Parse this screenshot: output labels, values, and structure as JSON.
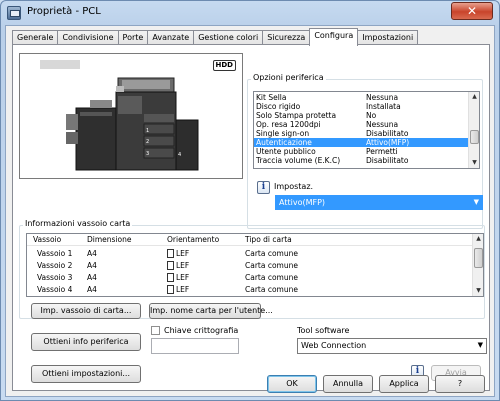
{
  "window": {
    "title": "Proprietà - PCL",
    "close_glyph": "✕"
  },
  "tabs": [
    "Generale",
    "Condivisione",
    "Porte",
    "Avanzate",
    "Gestione colori",
    "Sicurezza",
    "Configura",
    "Impostazioni"
  ],
  "active_tab": "Configura",
  "device_image": {
    "hdd_badge": "HDD"
  },
  "options": {
    "group_title": "Opzioni periferica",
    "rows": [
      {
        "name": "Kit Sella",
        "value": "Nessuna"
      },
      {
        "name": "Disco rigido",
        "value": "Installata"
      },
      {
        "name": "Solo Stampa protetta",
        "value": "No"
      },
      {
        "name": "Op. resa 1200dpi",
        "value": "Nessuna"
      },
      {
        "name": "Single sign-on",
        "value": "Disabilitato"
      },
      {
        "name": "Autenticazione",
        "value": "Attivo(MFP)"
      },
      {
        "name": "Utente pubblico",
        "value": "Permetti"
      },
      {
        "name": "Traccia volume (E.K.C)",
        "value": "Disabilitato"
      }
    ],
    "selected_index": 5,
    "setting_label": "Impostaz.",
    "setting_value": "Attivo(MFP)"
  },
  "tray_info": {
    "group_title": "Informazioni vassoio carta",
    "columns": [
      "Vassoio",
      "Dimensione",
      "Orientamento",
      "Tipo di carta"
    ],
    "rows": [
      {
        "tray": "Vassoio 1",
        "size": "A4",
        "orientation": "LEF",
        "type": "Carta comune"
      },
      {
        "tray": "Vassoio 2",
        "size": "A4",
        "orientation": "LEF",
        "type": "Carta comune"
      },
      {
        "tray": "Vassoio 3",
        "size": "A4",
        "orientation": "LEF",
        "type": "Carta comune"
      },
      {
        "tray": "Vassoio 4",
        "size": "A4",
        "orientation": "LEF",
        "type": "Carta comune"
      }
    ]
  },
  "buttons": {
    "tray_settings": "Imp. vassoio di carta...",
    "paper_name": "Imp. nome carta per l'utente...",
    "get_device_info": "Ottieni info periferica",
    "get_settings": "Ottieni impostazioni...",
    "apply_small": "Avvia",
    "ok": "OK",
    "cancel": "Annulla",
    "apply": "Applica",
    "help": "?"
  },
  "encryption": {
    "label": "Chiave crittografia",
    "checked": false,
    "value": ""
  },
  "software_tool": {
    "label": "Tool software",
    "value": "Web Connection"
  },
  "icons": {
    "info": "i",
    "dropdown": "▼",
    "scroll_up": "▲",
    "scroll_down": "▼"
  }
}
